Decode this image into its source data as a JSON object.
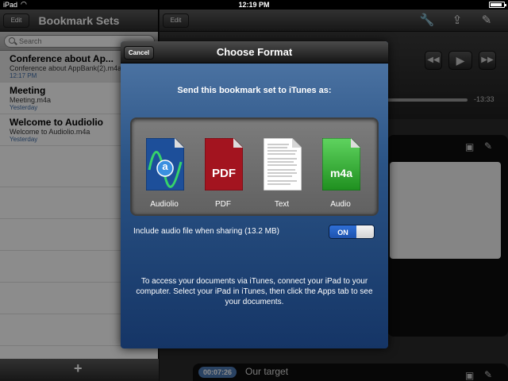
{
  "status_bar": {
    "carrier": "iPad",
    "time": "12:19 PM",
    "battery_percent": 85
  },
  "left_pane": {
    "edit_label": "Edit",
    "title": "Bookmark Sets",
    "search_placeholder": "Search",
    "items": [
      {
        "name": "Conference about Ap...",
        "file": "Conference about AppBank(2).m4a",
        "date": "12:17 PM",
        "selected": true
      },
      {
        "name": "Meeting",
        "file": "Meeting.m4a",
        "date": "Yesterday",
        "selected": false
      },
      {
        "name": "Welcome to Audiolio",
        "file": "Welcome to Audiolio.m4a",
        "date": "Yesterday",
        "selected": false
      }
    ],
    "add_label": "+"
  },
  "right_pane": {
    "edit_label": "Edit",
    "remaining_time": "-13:33",
    "card_time": "00:07:26",
    "card_title": "Our target"
  },
  "modal": {
    "cancel_label": "Cancel",
    "title": "Choose Format",
    "prompt": "Send this bookmark set to iTunes as:",
    "formats": [
      {
        "label": "Audiolio",
        "badge": "a",
        "color": "#1d4f9a"
      },
      {
        "label": "PDF",
        "badge": "PDF",
        "color": "#a3141f"
      },
      {
        "label": "Text",
        "badge": "",
        "color": "#ffffff"
      },
      {
        "label": "Audio",
        "badge": "m4a",
        "color": "#2aa12a"
      }
    ],
    "include_audio_label": "Include audio file when sharing (13.2 MB)",
    "toggle_label": "ON",
    "help_text": "To access your documents via iTunes, connect your iPad to your computer. Select your iPad in iTunes, then click the Apps tab to see your documents."
  }
}
